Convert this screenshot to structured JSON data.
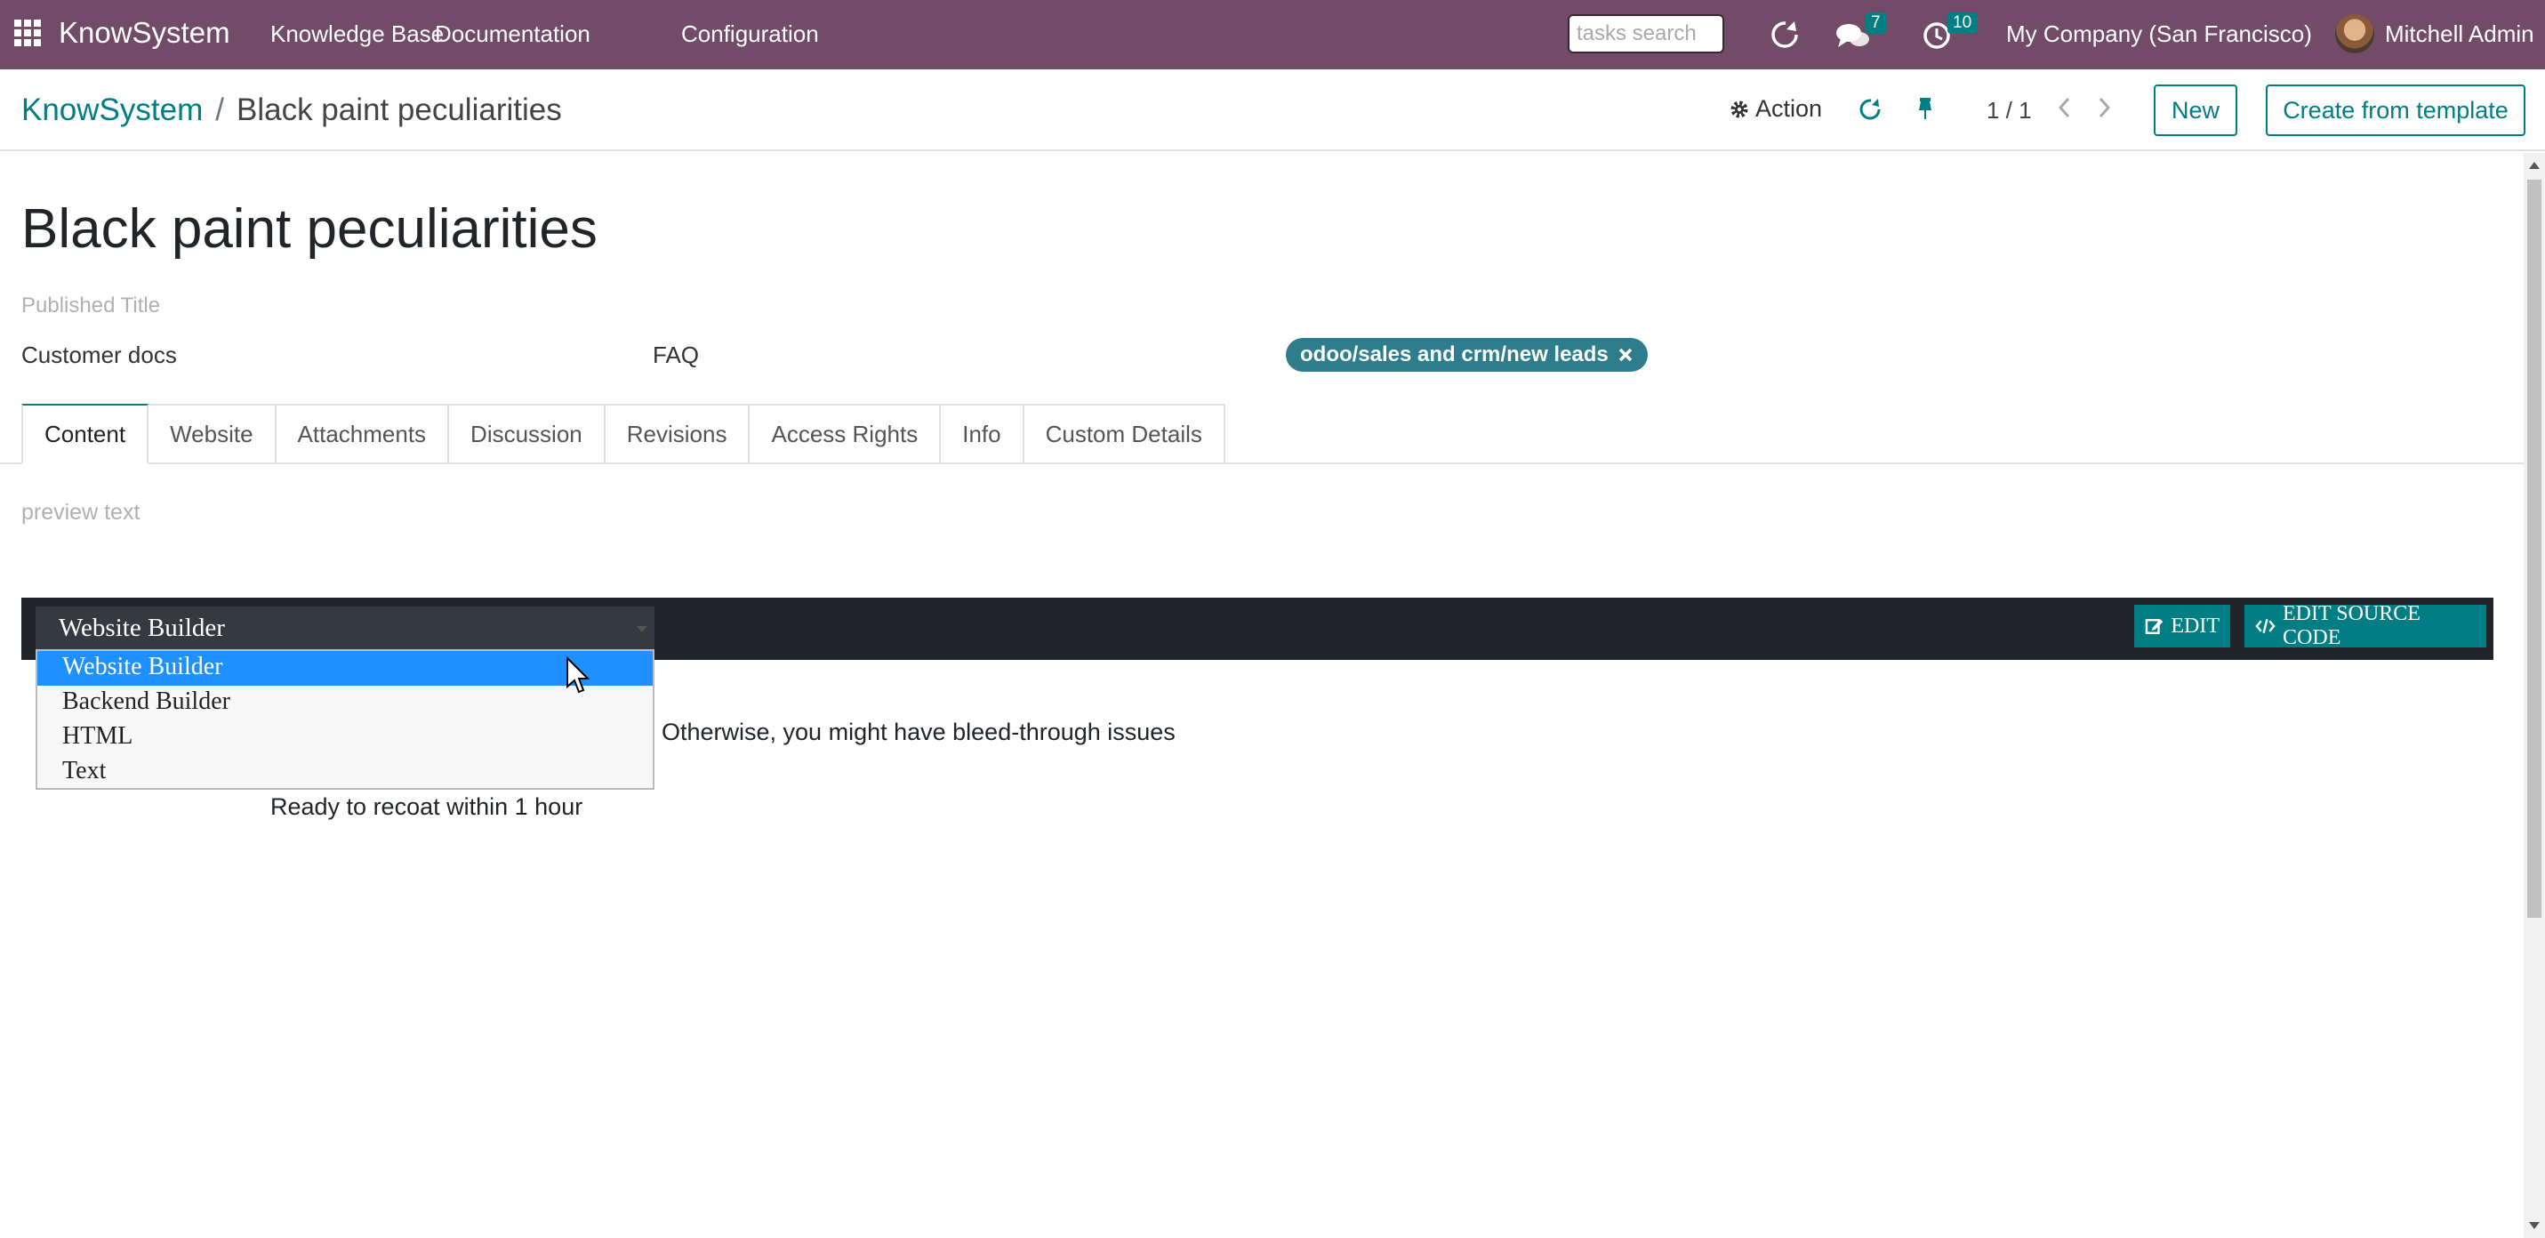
{
  "navbar": {
    "brand": "KnowSystem",
    "menus": [
      "Knowledge Base",
      "Documentation",
      "Configuration"
    ],
    "tasks_search_placeholder": "tasks search",
    "messages_count": "7",
    "activities_count": "10",
    "company": "My Company (San Francisco)",
    "user": "Mitchell Admin",
    "color": "#714b67"
  },
  "control_panel": {
    "breadcrumb_root": "KnowSystem",
    "breadcrumb_separator": "/",
    "breadcrumb_current": "Black paint peculiarities",
    "action_label": "Action",
    "pager": "1 / 1",
    "new_label": "New",
    "create_from_template_label": "Create from template"
  },
  "form": {
    "title": "Black paint peculiarities",
    "published_title_placeholder": "Published Title",
    "section": "Customer docs",
    "type": "FAQ",
    "tag": "odoo/sales and crm/new leads",
    "tabs": [
      "Content",
      "Website",
      "Attachments",
      "Discussion",
      "Revisions",
      "Access Rights",
      "Info",
      "Custom Details"
    ],
    "active_tab": "Content",
    "preview_text_placeholder": "preview text"
  },
  "editor": {
    "selected_mode": "Website Builder",
    "options": [
      "Website Builder",
      "Backend Builder",
      "HTML",
      "Text"
    ],
    "edit_label": "EDIT",
    "edit_source_label": "EDIT SOURCE CODE",
    "accent": "#017e84"
  },
  "content": {
    "line1": "Otherwise, you might have bleed-through issues",
    "line2": "Ready to recoat within 1 hour"
  }
}
